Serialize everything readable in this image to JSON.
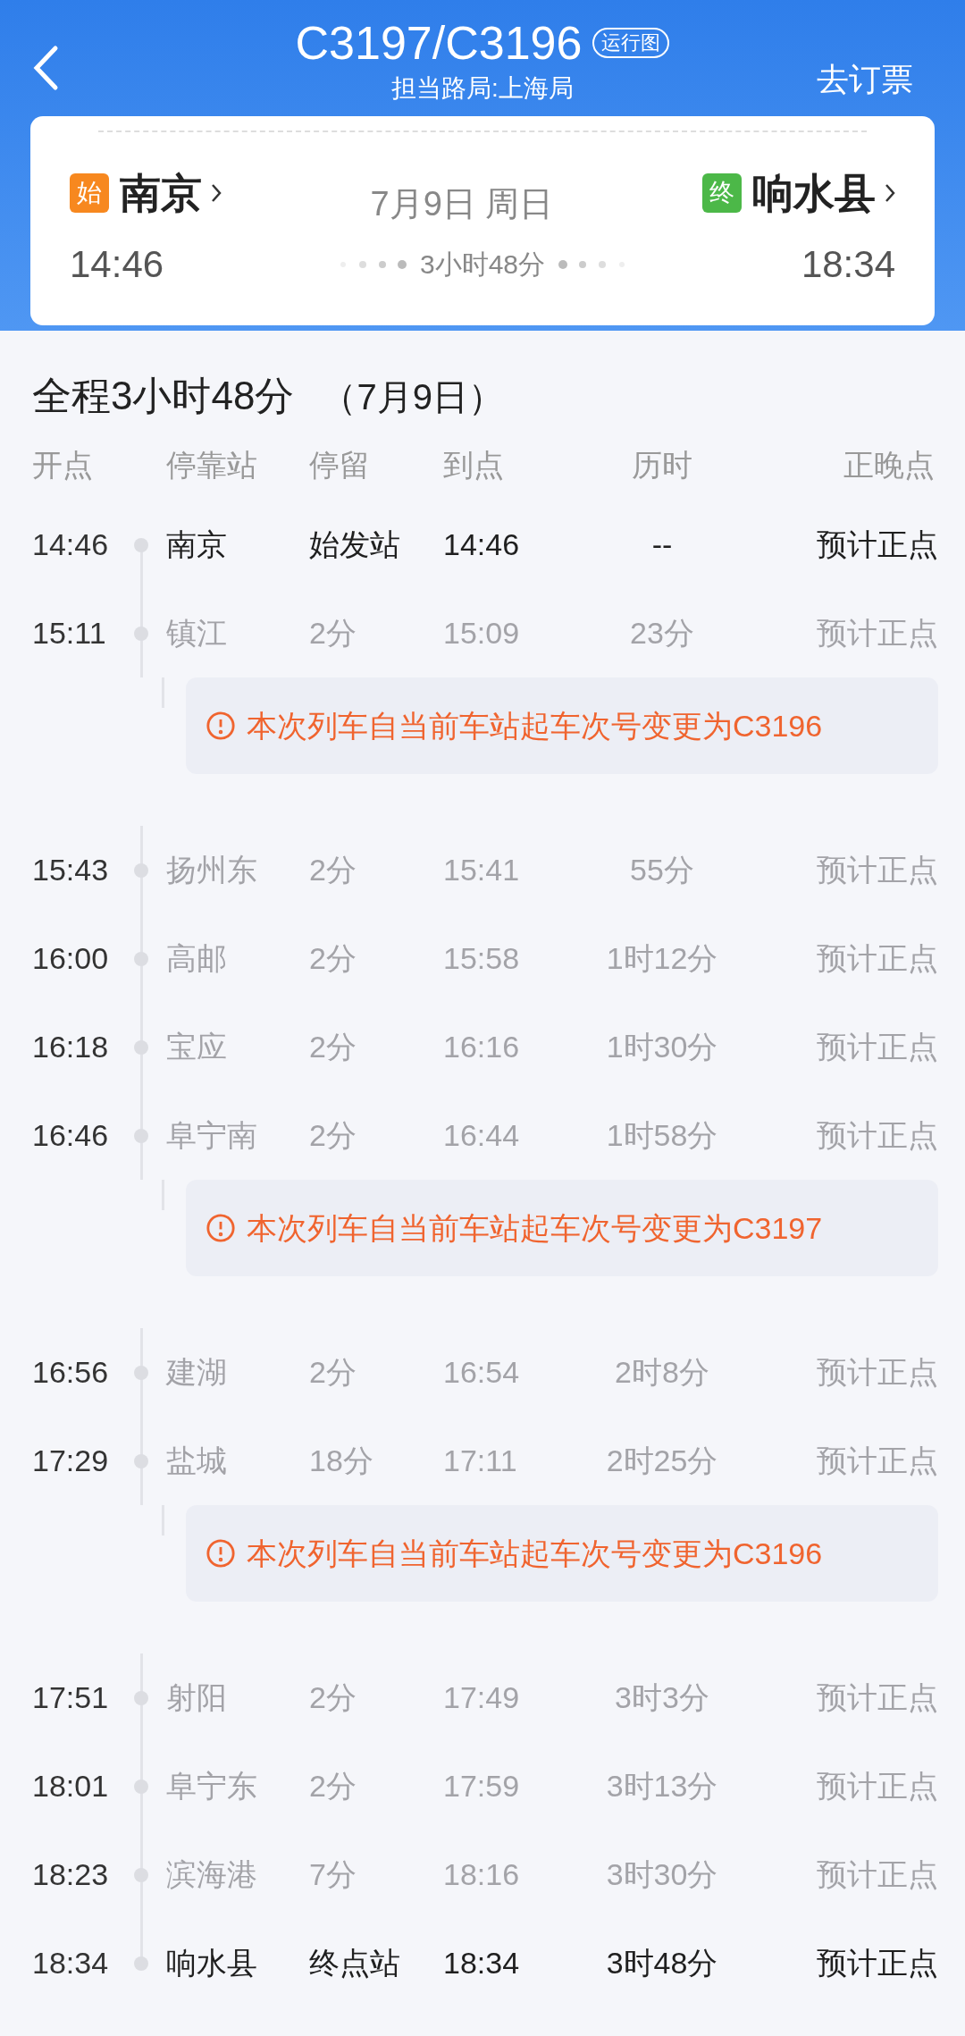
{
  "header": {
    "train": "C3197/C3196",
    "diagram_badge": "运行图",
    "bureau": "担当路局:上海局",
    "book": "去订票"
  },
  "journey": {
    "from": {
      "badge": "始",
      "name": "南京",
      "time": "14:46"
    },
    "date": "7月9日 周日",
    "duration": "3小时48分",
    "to": {
      "badge": "终",
      "name": "响水县",
      "time": "18:34"
    }
  },
  "summary": {
    "total": "全程3小时48分",
    "date": "（7月9日）"
  },
  "columns": [
    "开点",
    "停靠站",
    "停留",
    "到点",
    "历时",
    "正晚点"
  ],
  "rows": [
    {
      "kind": "stop",
      "emphasized": true,
      "depart": "14:46",
      "station": "南京",
      "stay": "始发站",
      "arrive": "14:46",
      "elapsed": "--",
      "status": "预计正点"
    },
    {
      "kind": "stop",
      "emphasized": false,
      "depart": "15:11",
      "station": "镇江",
      "stay": "2分",
      "arrive": "15:09",
      "elapsed": "23分",
      "status": "预计正点"
    },
    {
      "kind": "notice",
      "text": "本次列车自当前车站起车次号变更为C3196"
    },
    {
      "kind": "stop",
      "emphasized": false,
      "depart": "15:43",
      "station": "扬州东",
      "stay": "2分",
      "arrive": "15:41",
      "elapsed": "55分",
      "status": "预计正点"
    },
    {
      "kind": "stop",
      "emphasized": false,
      "depart": "16:00",
      "station": "高邮",
      "stay": "2分",
      "arrive": "15:58",
      "elapsed": "1时12分",
      "status": "预计正点"
    },
    {
      "kind": "stop",
      "emphasized": false,
      "depart": "16:18",
      "station": "宝应",
      "stay": "2分",
      "arrive": "16:16",
      "elapsed": "1时30分",
      "status": "预计正点"
    },
    {
      "kind": "stop",
      "emphasized": false,
      "depart": "16:46",
      "station": "阜宁南",
      "stay": "2分",
      "arrive": "16:44",
      "elapsed": "1时58分",
      "status": "预计正点"
    },
    {
      "kind": "notice",
      "text": "本次列车自当前车站起车次号变更为C3197"
    },
    {
      "kind": "stop",
      "emphasized": false,
      "depart": "16:56",
      "station": "建湖",
      "stay": "2分",
      "arrive": "16:54",
      "elapsed": "2时8分",
      "status": "预计正点"
    },
    {
      "kind": "stop",
      "emphasized": false,
      "depart": "17:29",
      "station": "盐城",
      "stay": "18分",
      "arrive": "17:11",
      "elapsed": "2时25分",
      "status": "预计正点"
    },
    {
      "kind": "notice",
      "text": "本次列车自当前车站起车次号变更为C3196"
    },
    {
      "kind": "stop",
      "emphasized": false,
      "depart": "17:51",
      "station": "射阳",
      "stay": "2分",
      "arrive": "17:49",
      "elapsed": "3时3分",
      "status": "预计正点"
    },
    {
      "kind": "stop",
      "emphasized": false,
      "depart": "18:01",
      "station": "阜宁东",
      "stay": "2分",
      "arrive": "17:59",
      "elapsed": "3时13分",
      "status": "预计正点"
    },
    {
      "kind": "stop",
      "emphasized": false,
      "depart": "18:23",
      "station": "滨海港",
      "stay": "7分",
      "arrive": "18:16",
      "elapsed": "3时30分",
      "status": "预计正点"
    },
    {
      "kind": "stop",
      "emphasized": true,
      "depart": "18:34",
      "station": "响水县",
      "stay": "终点站",
      "arrive": "18:34",
      "elapsed": "3时48分",
      "status": "预计正点"
    }
  ]
}
